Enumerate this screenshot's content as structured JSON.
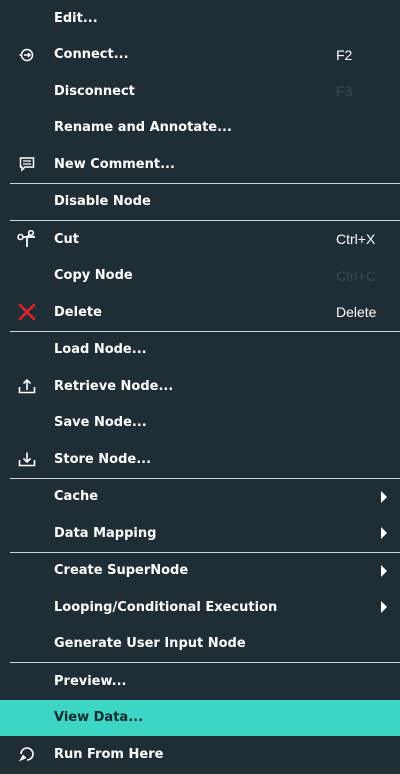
{
  "menu": {
    "items": [
      {
        "label": "Edit..."
      },
      {
        "label": "Connect...",
        "shortcut": "F2",
        "icon": "connect-icon"
      },
      {
        "label": "Disconnect",
        "shortcut": "F3"
      },
      {
        "label": "Rename and Annotate..."
      },
      {
        "label": "New Comment...",
        "icon": "comment-icon"
      },
      {
        "label": "Disable Node"
      },
      {
        "label": "Cut",
        "shortcut": "Ctrl+X",
        "icon": "scissors-icon"
      },
      {
        "label": "Copy Node",
        "shortcut": "Ctrl+C"
      },
      {
        "label": "Delete",
        "shortcut": "Delete",
        "icon": "delete-x-icon"
      },
      {
        "label": "Load Node..."
      },
      {
        "label": "Retrieve Node...",
        "icon": "retrieve-icon"
      },
      {
        "label": "Save Node..."
      },
      {
        "label": "Store Node...",
        "icon": "store-icon"
      },
      {
        "label": "Cache",
        "submenu": true
      },
      {
        "label": "Data Mapping",
        "submenu": true
      },
      {
        "label": "Create SuperNode",
        "submenu": true
      },
      {
        "label": "Looping/Conditional Execution",
        "submenu": true
      },
      {
        "label": "Generate User Input Node"
      },
      {
        "label": "Preview..."
      },
      {
        "label": "View Data...",
        "highlighted": true
      },
      {
        "label": "Run From Here",
        "icon": "run-from-here-icon"
      }
    ]
  },
  "colors": {
    "background": "#1f2e35",
    "highlight": "#3dd6c5",
    "delete_icon": "#e8202a",
    "disabled_shortcut": "#3b4b53"
  }
}
